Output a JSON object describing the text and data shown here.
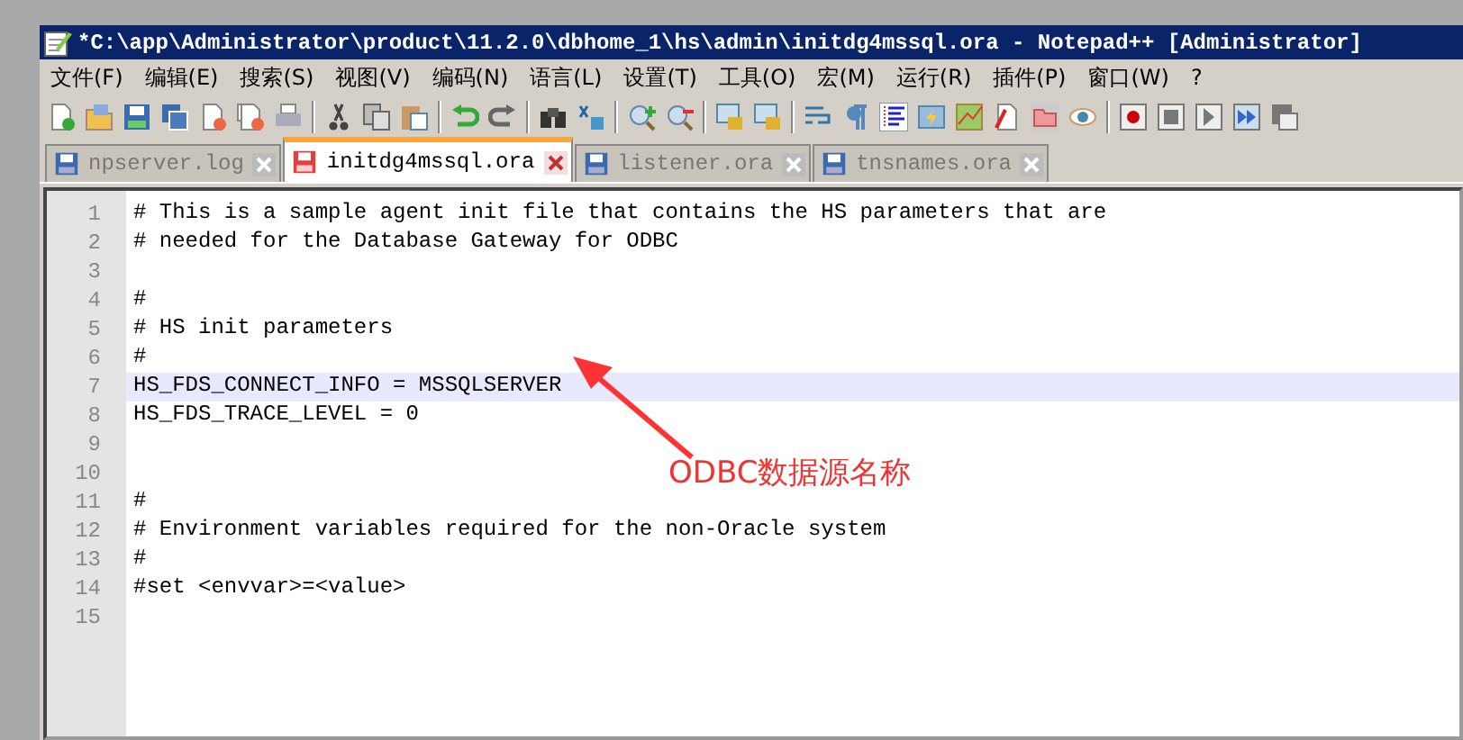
{
  "window": {
    "title": "*C:\\app\\Administrator\\product\\11.2.0\\dbhome_1\\hs\\admin\\initdg4mssql.ora - Notepad++ [Administrator]"
  },
  "menu": [
    "文件(F)",
    "编辑(E)",
    "搜索(S)",
    "视图(V)",
    "编码(N)",
    "语言(L)",
    "设置(T)",
    "工具(O)",
    "宏(M)",
    "运行(R)",
    "插件(P)",
    "窗口(W)",
    "?"
  ],
  "tabs": [
    {
      "label": "npserver.log",
      "selected": false,
      "modified": false
    },
    {
      "label": "initdg4mssql.ora",
      "selected": true,
      "modified": true
    },
    {
      "label": "listener.ora",
      "selected": false,
      "modified": false
    },
    {
      "label": "tnsnames.ora",
      "selected": false,
      "modified": false
    }
  ],
  "editor": {
    "lines": [
      {
        "number": "1",
        "text": "# This is a sample agent init file that contains the HS parameters that are",
        "current": false
      },
      {
        "number": "2",
        "text": "# needed for the Database Gateway for ODBC",
        "current": false
      },
      {
        "number": "3",
        "current": false
      },
      {
        "number": "4",
        "text": "#",
        "current": false
      },
      {
        "number": "5",
        "text": "# HS init parameters",
        "current": false
      },
      {
        "number": "6",
        "text": "#",
        "current": false
      },
      {
        "number": "7",
        "text": "HS_FDS_CONNECT_INFO = MSSQLSERVER",
        "current": true
      },
      {
        "number": "8",
        "text": "HS_FDS_TRACE_LEVEL = 0",
        "current": false
      },
      {
        "number": "9",
        "current": false
      },
      {
        "number": "10",
        "current": false
      },
      {
        "number": "11",
        "text": "#",
        "current": false
      },
      {
        "number": "12",
        "text": "# Environment variables required for the non-Oracle system",
        "current": false
      },
      {
        "number": "13",
        "text": "#",
        "current": false
      },
      {
        "number": "14",
        "text": "#set <envvar>=<value>",
        "current": false
      },
      {
        "number": "15",
        "current": false
      }
    ]
  },
  "annotation": {
    "text": "ODBC数据源名称"
  }
}
